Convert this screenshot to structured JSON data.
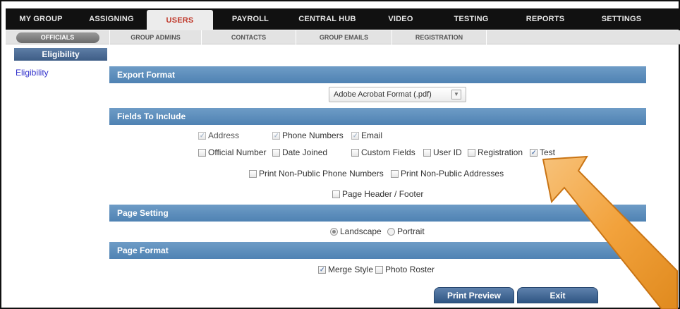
{
  "topnav": {
    "tabs": [
      {
        "label": "MY GROUP",
        "active": false
      },
      {
        "label": "ASSIGNING",
        "active": false
      },
      {
        "label": "USERS",
        "active": true
      },
      {
        "label": "PAYROLL",
        "active": false
      },
      {
        "label": "CENTRAL HUB",
        "active": false
      },
      {
        "label": "VIDEO",
        "active": false
      },
      {
        "label": "TESTING",
        "active": false
      },
      {
        "label": "REPORTS",
        "active": false
      },
      {
        "label": "SETTINGS",
        "active": false
      }
    ]
  },
  "subnav": {
    "items": [
      {
        "label": "OFFICIALS",
        "active": true
      },
      {
        "label": "GROUP ADMINS",
        "active": false
      },
      {
        "label": "CONTACTS",
        "active": false
      },
      {
        "label": "GROUP EMAILS",
        "active": false
      },
      {
        "label": "REGISTRATION",
        "active": false
      }
    ]
  },
  "sidebar": {
    "header": "Eligibility",
    "link": "Eligibility"
  },
  "sections": {
    "export_format": "Export Format",
    "fields_to_include": "Fields To Include",
    "page_setting": "Page Setting",
    "page_format": "Page Format"
  },
  "export_select": {
    "value": "Adobe Acrobat Format (.pdf)"
  },
  "fields": {
    "address": {
      "label": "Address",
      "checked": true
    },
    "phone_numbers": {
      "label": "Phone Numbers",
      "checked": true
    },
    "email": {
      "label": "Email",
      "checked": true
    },
    "official_number": {
      "label": "Official Number",
      "checked": false
    },
    "date_joined": {
      "label": "Date Joined",
      "checked": false
    },
    "custom_fields": {
      "label": "Custom Fields",
      "checked": false
    },
    "user_id": {
      "label": "User ID",
      "checked": false
    },
    "registration": {
      "label": "Registration",
      "checked": false
    },
    "test": {
      "label": "Test",
      "checked": true
    },
    "nonpublic_phones": {
      "label": "Print Non-Public Phone Numbers",
      "checked": false
    },
    "nonpublic_addresses": {
      "label": "Print Non-Public Addresses",
      "checked": false
    },
    "header_footer": {
      "label": "Page Header / Footer",
      "checked": false
    }
  },
  "page_setting": {
    "landscape": {
      "label": "Landscape",
      "selected": true
    },
    "portrait": {
      "label": "Portrait",
      "selected": false
    }
  },
  "page_format": {
    "merge_style": {
      "label": "Merge Style",
      "checked": true
    },
    "photo_roster": {
      "label": "Photo Roster",
      "checked": false
    }
  },
  "buttons": {
    "print_preview": "Print Preview",
    "exit": "Exit"
  },
  "colors": {
    "section_bar": "#5a8bbb",
    "nav_bg": "#111111",
    "active_tab_text": "#c0392b",
    "annotation_arrow": "#f0a030"
  }
}
